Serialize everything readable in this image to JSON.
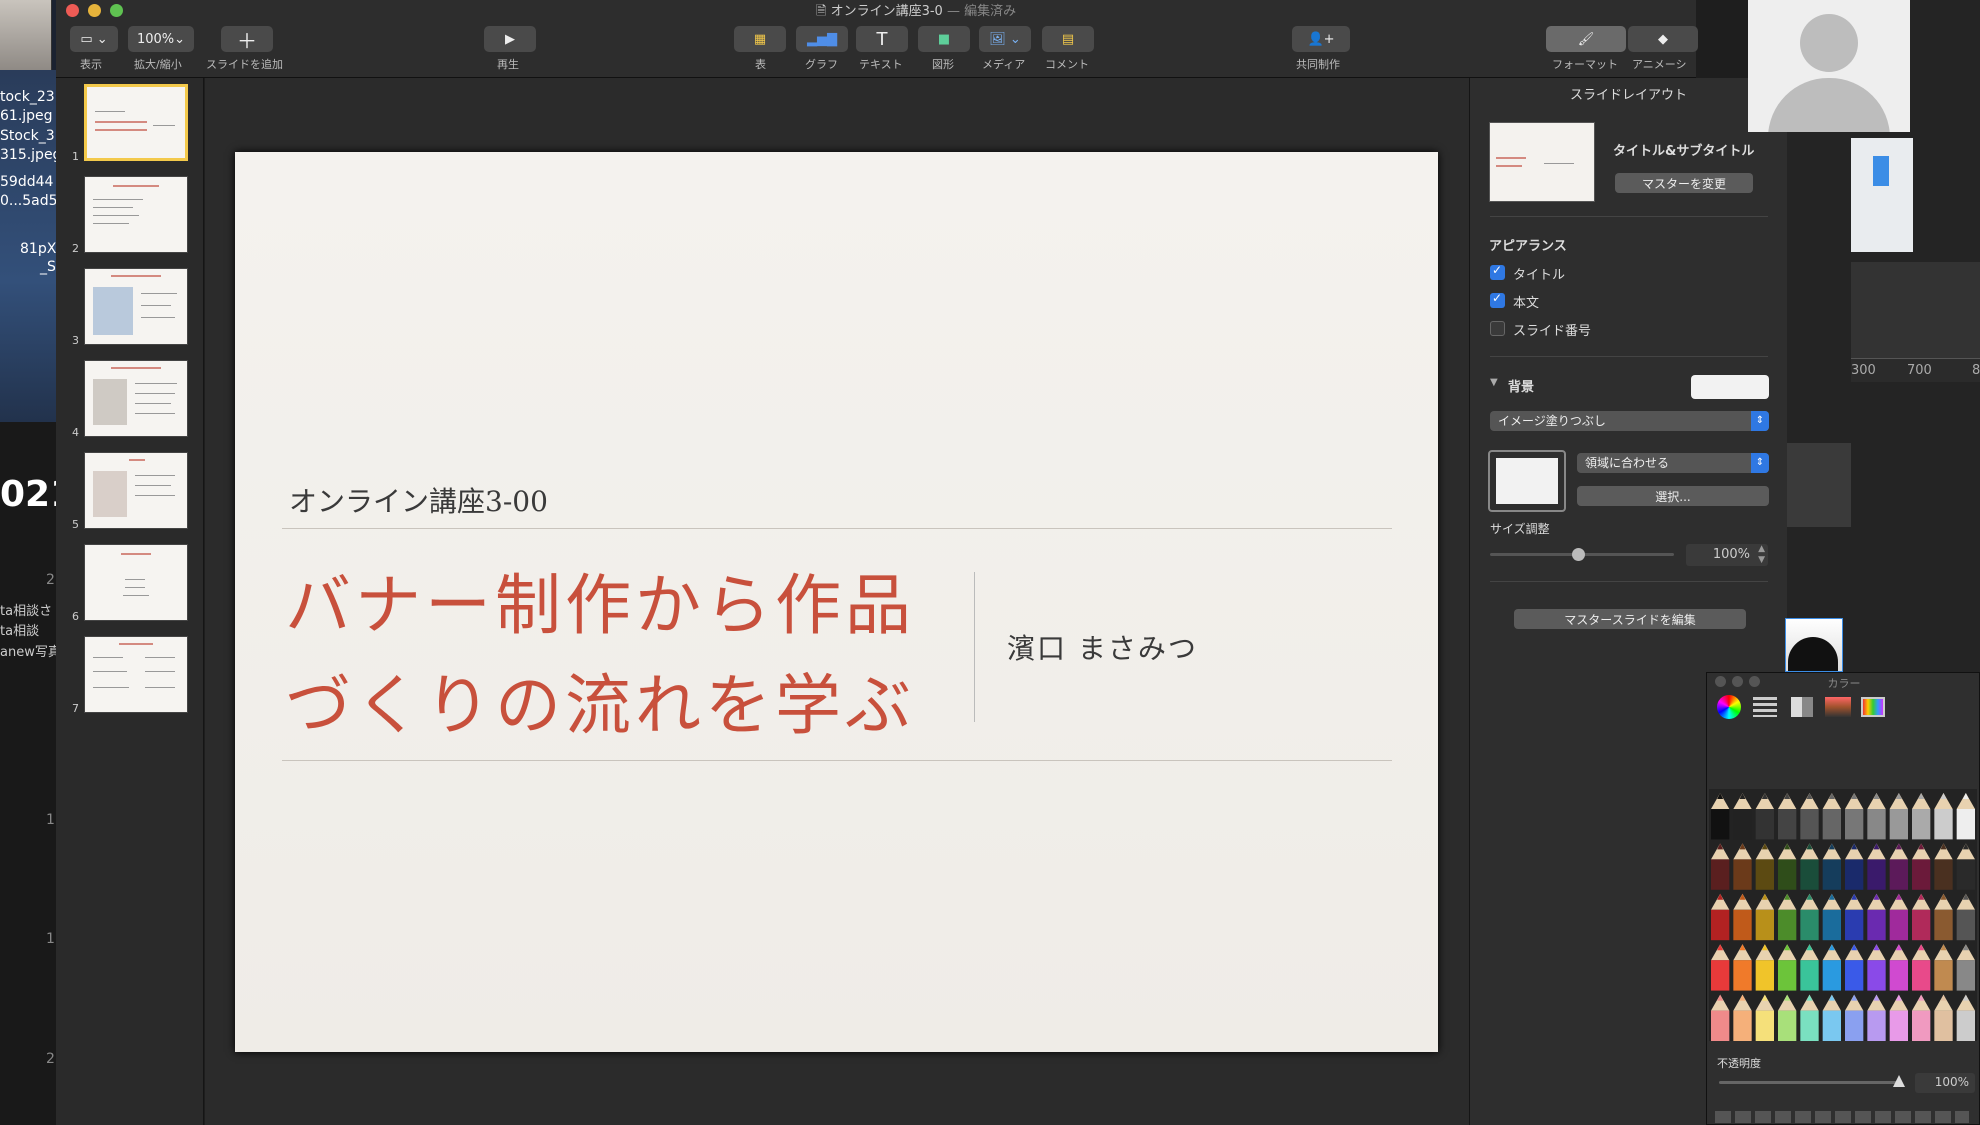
{
  "desktop": {
    "files": [
      "tock_23",
      "61.jpeg",
      "Stock_3",
      "315.jpeg",
      "59dd44",
      "0...5ad5",
      "81pX",
      "_S"
    ],
    "year_fragment": "021",
    "side_texts": [
      "ta相談さ",
      "ta相談",
      "anew写真"
    ],
    "numbers": [
      "2",
      "1",
      "1",
      "2"
    ]
  },
  "window": {
    "title": "オンライン講座3-0",
    "title_status": "— 編集済み"
  },
  "toolbar": {
    "view_label": "表示",
    "zoom_value": "100%",
    "zoom_label": "拡大/縮小",
    "add_slide_label": "スライドを追加",
    "play_label": "再生",
    "table_label": "表",
    "chart_label": "グラフ",
    "text_label": "テキスト",
    "shape_label": "図形",
    "media_label": "メディア",
    "comment_label": "コメント",
    "collab_label": "共同制作",
    "format_label": "フォーマット",
    "animate_label": "アニメーシ"
  },
  "navigator": {
    "slides": [
      {
        "num": "1",
        "selected": true
      },
      {
        "num": "2",
        "selected": false
      },
      {
        "num": "3",
        "selected": false
      },
      {
        "num": "4",
        "selected": false
      },
      {
        "num": "5",
        "selected": false
      },
      {
        "num": "6",
        "selected": false
      },
      {
        "num": "7",
        "selected": false
      }
    ]
  },
  "slide": {
    "subtitle": "オンライン講座3-00",
    "title_line1": "バナー制作から作品",
    "title_line2": "づくりの流れを学ぶ",
    "author": "濱口 まさみつ"
  },
  "inspector": {
    "header": "スライドレイアウト",
    "layout_name": "タイトル&サブタイトル",
    "change_master": "マスターを変更",
    "appearance": "アピアランス",
    "chk_title": "タイトル",
    "chk_body": "本文",
    "chk_slide_number": "スライド番号",
    "background": "背景",
    "fill_type": "イメージ塗りつぶし",
    "scale_mode": "領域に合わせる",
    "choose": "選択...",
    "size_adjust": "サイズ調整",
    "size_value": "100%",
    "edit_master": "マスタースライドを編集"
  },
  "ruler": {
    "marks": [
      "300",
      "700",
      "8"
    ]
  },
  "colors_panel": {
    "title": "カラー",
    "opacity_label": "不透明度",
    "opacity_value": "100%"
  },
  "theme_colors": {
    "accent": "#c8503c",
    "selection": "#f3c94b",
    "toggle": "#2f78e3"
  }
}
